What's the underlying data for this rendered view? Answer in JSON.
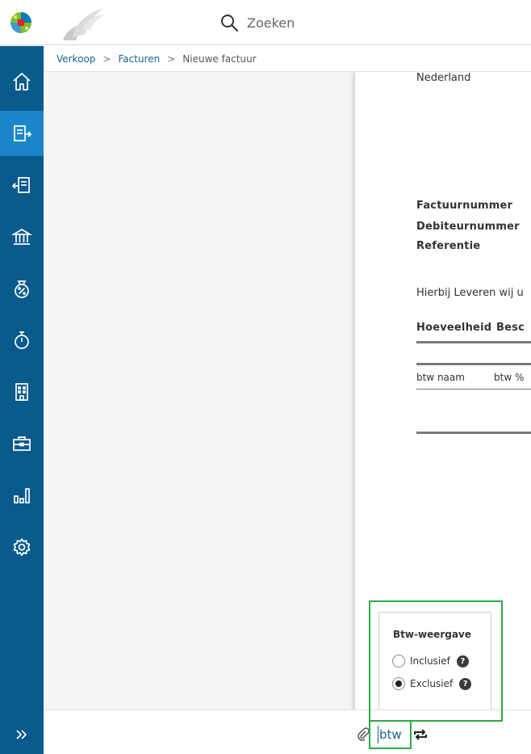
{
  "search": {
    "placeholder": "Zoeken"
  },
  "sidebar": {
    "items": [
      {
        "name": "home",
        "icon": "home-icon",
        "active": false
      },
      {
        "name": "verkoop",
        "icon": "invoice-out-icon",
        "active": true
      },
      {
        "name": "inkoop",
        "icon": "invoice-in-icon",
        "active": false
      },
      {
        "name": "bank",
        "icon": "bank-icon",
        "active": false
      },
      {
        "name": "btw",
        "icon": "percent-bag-icon",
        "active": false
      },
      {
        "name": "uren",
        "icon": "stopwatch-icon",
        "active": false
      },
      {
        "name": "relaties",
        "icon": "building-icon",
        "active": false
      },
      {
        "name": "projecten",
        "icon": "briefcase-icon",
        "active": false
      },
      {
        "name": "rapportages",
        "icon": "bar-chart-icon",
        "active": false
      },
      {
        "name": "instellingen",
        "icon": "gear-icon",
        "active": false
      }
    ],
    "expand_icon": "double-chevron-right-icon"
  },
  "breadcrumb": {
    "item1": "Verkoop",
    "item2": "Facturen",
    "current": "Nieuwe factuur"
  },
  "invoice": {
    "country": "Nederland",
    "invoice_number_label": "Factuurnummer",
    "debtor_number_label": "Debiteurnummer",
    "reference_label": "Referentie",
    "intro_text": "Hierbij Leveren wij u",
    "col_quantity": "Hoeveelheid",
    "col_description": "Besc",
    "vat_name_col": "btw naam",
    "vat_pct_col": "btw %"
  },
  "btw_panel": {
    "title": "Btw-weergave",
    "option_incl": "Inclusief",
    "option_excl": "Exclusief",
    "selected": "Exclusief",
    "help_glyph": "?"
  },
  "bottombar": {
    "field_text": "btw"
  },
  "colors": {
    "sidebar": "#0a5a8c",
    "sidebar_active": "#1a86c9",
    "highlight": "#2eaa45",
    "link": "#1a5f8c"
  }
}
